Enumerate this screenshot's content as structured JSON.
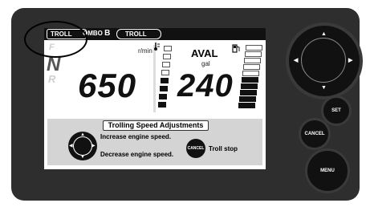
{
  "topbar": {
    "troll_badge": "TROLL",
    "combo_label": "OMBO",
    "combo_letter": "B",
    "troll_badge_2": "TROLL"
  },
  "gears": {
    "forward": "F",
    "neutral": "N",
    "reverse": "R"
  },
  "engine": {
    "rpm_value": "650",
    "rpm_unit": "r/min"
  },
  "fuel": {
    "label": "AVAL",
    "unit": "gal",
    "value": "240"
  },
  "adjustments": {
    "title": "Trolling Speed Adjustments",
    "increase": "Increase engine speed.",
    "decrease": "Decrease engine speed.",
    "cancel_badge": "CANCEL",
    "troll_stop": "Troll stop"
  },
  "hardware": {
    "set": "SET",
    "cancel": "CANCEL",
    "menu": "MENU"
  },
  "icons": {
    "thermometer": "thermometer-icon",
    "fuel": "fuel-pump-icon",
    "dpad": "directional-pad-icon"
  }
}
